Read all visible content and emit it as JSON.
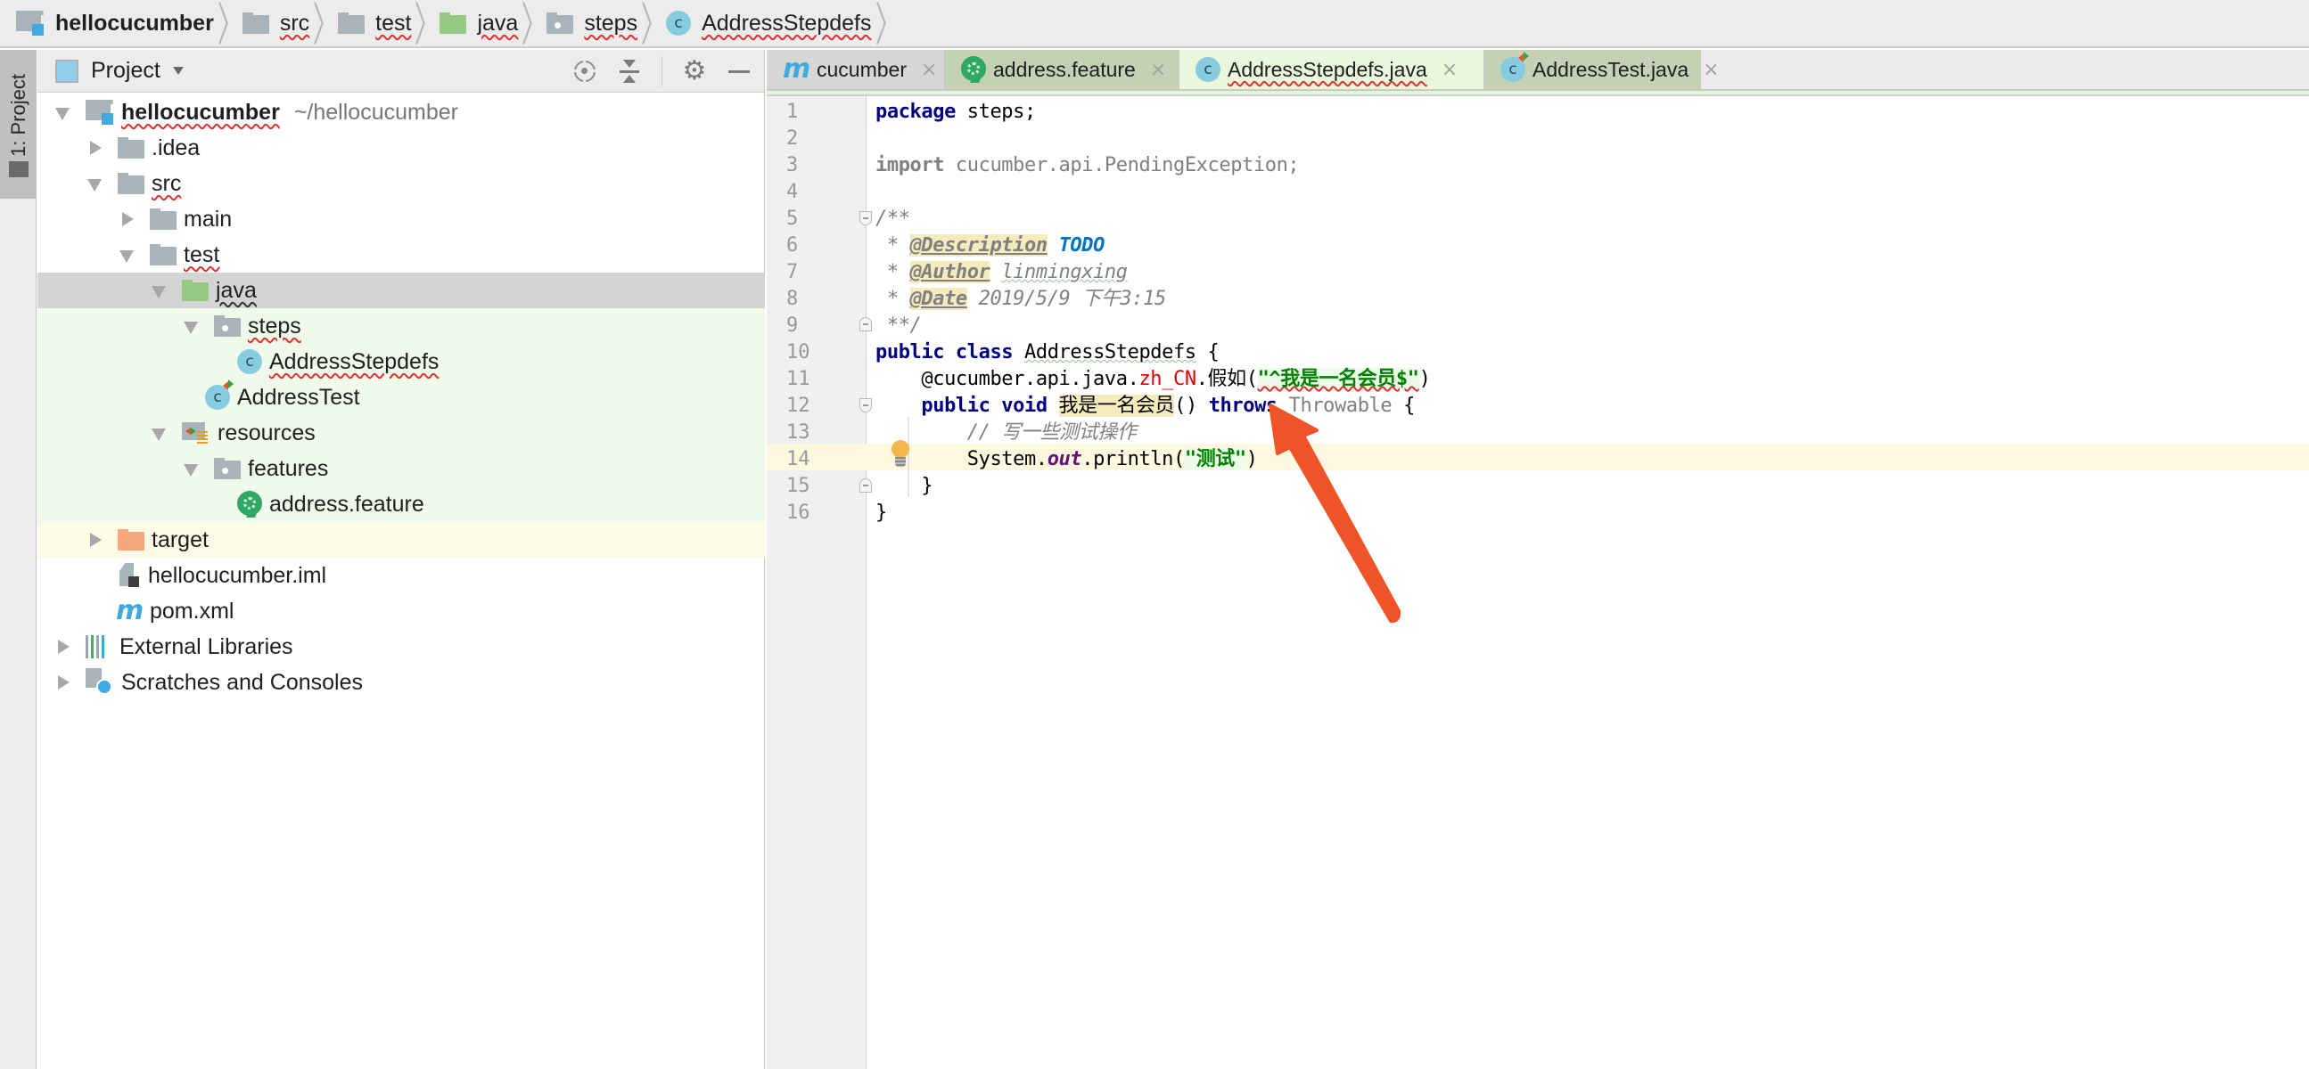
{
  "breadcrumb": [
    {
      "label": "hellocucumber",
      "icon": "module-folder-icon",
      "bold": true
    },
    {
      "label": "src",
      "icon": "folder-icon"
    },
    {
      "label": "test",
      "icon": "folder-icon"
    },
    {
      "label": "java",
      "icon": "test-source-folder-icon"
    },
    {
      "label": "steps",
      "icon": "package-icon"
    },
    {
      "label": "AddressStepdefs",
      "icon": "class-icon",
      "icon_glyph": "c"
    }
  ],
  "left_stripe": {
    "project_label": "1: Project"
  },
  "project_panel": {
    "title": "Project",
    "tools": [
      "locate-icon",
      "collapse-all-icon",
      "gear-icon",
      "minimize-icon"
    ],
    "gear_glyph": "⚙",
    "tree": [
      {
        "label": "hellocucumber",
        "sub": "~/hellocucumber",
        "level": 0,
        "expanded": true,
        "icon": "module-folder-icon"
      },
      {
        "label": ".idea",
        "level": 1,
        "expanded": false,
        "icon": "folder-icon"
      },
      {
        "label": "src",
        "level": 1,
        "expanded": true,
        "icon": "folder-icon"
      },
      {
        "label": "main",
        "level": 2,
        "expanded": false,
        "icon": "folder-icon"
      },
      {
        "label": "test",
        "level": 2,
        "expanded": true,
        "icon": "folder-icon"
      },
      {
        "label": "java",
        "level": 3,
        "expanded": true,
        "icon": "test-source-folder-icon",
        "selected": true
      },
      {
        "label": "steps",
        "level": 4,
        "expanded": true,
        "icon": "package-icon"
      },
      {
        "label": "AddressStepdefs",
        "level": 5,
        "icon": "class-icon"
      },
      {
        "label": "AddressTest",
        "level": 4,
        "icon": "test-class-icon"
      },
      {
        "label": "resources",
        "level": 3,
        "expanded": true,
        "icon": "test-resources-folder-icon"
      },
      {
        "label": "features",
        "level": 4,
        "expanded": true,
        "icon": "package-icon"
      },
      {
        "label": "address.feature",
        "level": 5,
        "icon": "cucumber-feature-icon"
      },
      {
        "label": "target",
        "level": 1,
        "expanded": false,
        "icon": "excluded-folder-icon"
      },
      {
        "label": "hellocucumber.iml",
        "level": 1,
        "icon": "iml-file-icon"
      },
      {
        "label": "pom.xml",
        "level": 1,
        "icon": "maven-icon"
      },
      {
        "label": "External Libraries",
        "level": 0,
        "expanded": false,
        "icon": "libraries-icon"
      },
      {
        "label": "Scratches and Consoles",
        "level": 0,
        "expanded": false,
        "icon": "scratches-icon"
      }
    ]
  },
  "editor": {
    "tabs": [
      {
        "label": "cucumber",
        "icon": "maven-icon",
        "active": false
      },
      {
        "label": "address.feature",
        "icon": "cucumber-feature-icon",
        "active": false
      },
      {
        "label": "AddressStepdefs.java",
        "icon": "class-icon",
        "active": true
      },
      {
        "label": "AddressTest.java",
        "icon": "test-class-icon",
        "active": false
      }
    ],
    "close_glyph": "×",
    "maven_glyph": "m",
    "class_glyph": "c",
    "line_numbers": [
      "1",
      "2",
      "3",
      "4",
      "5",
      "6",
      "7",
      "8",
      "9",
      "10",
      "11",
      "12",
      "13",
      "14",
      "15",
      "16"
    ],
    "current_line": 14,
    "code": {
      "l1_kw": "package",
      "l1_rest": " steps;",
      "l3_kw": "import",
      "l3_rest": " cucumber.api.PendingException;",
      "l5": "/**",
      "l6_star": " * ",
      "l6_tag": "@Description",
      "l6_todo": "TODO",
      "l7_star": " * ",
      "l7_tag": "@Author",
      "l7_val": "linmingxing",
      "l8_star": " * ",
      "l8_tag": "@Date",
      "l8_val": " 2019/5/9 下午3:15",
      "l9": " **/",
      "l10_kw": "public class",
      "l10_name": "AddressStepdefs",
      "l10_rest": " {",
      "l11_pre": "    @cucumber.api.java.",
      "l11_red": "zh_CN",
      "l11_mid": ".假如(",
      "l11_str": "\"^我是一名会员$\"",
      "l11_end": ")",
      "l12_kw": "    public void",
      "l12_name": "我是一名会员",
      "l12_mid": "() ",
      "l12_throws": "throws",
      "l12_type": " Throwable",
      "l12_end": " {",
      "l13": "        // 写一些测试操作",
      "l14_pre": "        System.",
      "l14_field": "out",
      "l14_mid": ".println(",
      "l14_str": "\"测试\"",
      "l14_end": ")",
      "l15": "    }",
      "l16": "}"
    }
  },
  "annotation": {
    "type": "arrow",
    "color": "#ee5428",
    "points_to": "throws keyword on line 12"
  },
  "colors": {
    "selection": "#d4d4d4",
    "test_source_bg": "#effaea",
    "excluded_bg": "#fdfbe5",
    "active_tab": "#e9f7dc",
    "current_line": "#fff8e1",
    "keyword": "#000080",
    "string": "#008000"
  }
}
